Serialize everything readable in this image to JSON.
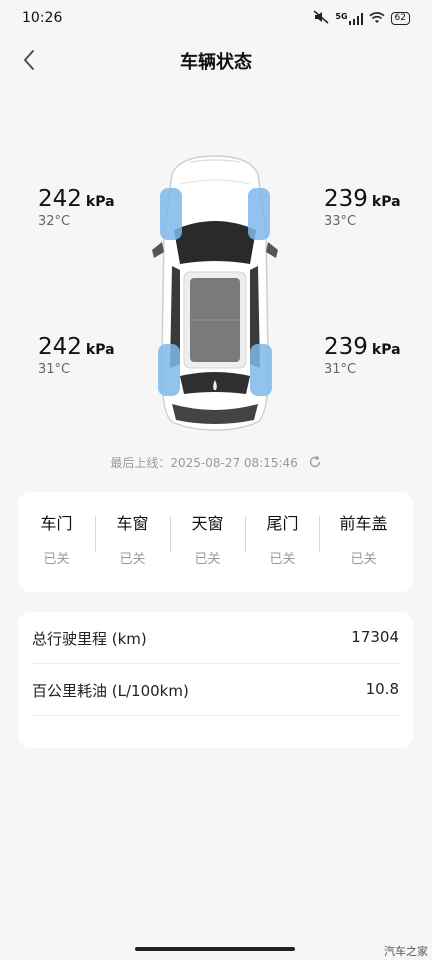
{
  "status_bar": {
    "time": "10:26",
    "network": "5G",
    "battery": "62"
  },
  "header": {
    "title": "车辆状态",
    "back_icon": "chevron-left-icon"
  },
  "tires": {
    "front_left": {
      "pressure": "242",
      "unit": "kPa",
      "temp": "32°C"
    },
    "front_right": {
      "pressure": "239",
      "unit": "kPa",
      "temp": "33°C"
    },
    "rear_left": {
      "pressure": "242",
      "unit": "kPa",
      "temp": "31°C"
    },
    "rear_right": {
      "pressure": "239",
      "unit": "kPa",
      "temp": "31°C"
    }
  },
  "last_online": {
    "text": "最后上线：2025-08-27 08:15:46",
    "icon": "refresh-icon"
  },
  "openings": [
    {
      "label": "车门",
      "status": "已关"
    },
    {
      "label": "车窗",
      "status": "已关"
    },
    {
      "label": "天窗",
      "status": "已关"
    },
    {
      "label": "尾门",
      "status": "已关"
    },
    {
      "label": "前车盖",
      "status": "已关"
    }
  ],
  "stats": [
    {
      "label": "总行驶里程 (km)",
      "value": "17304"
    },
    {
      "label": "百公里耗油 (L/100km)",
      "value": "10.8"
    }
  ],
  "watermark": "汽车之家",
  "colors": {
    "background": "#f6f6f6",
    "card": "#ffffff",
    "tire_highlight": "#7fb8ec"
  }
}
